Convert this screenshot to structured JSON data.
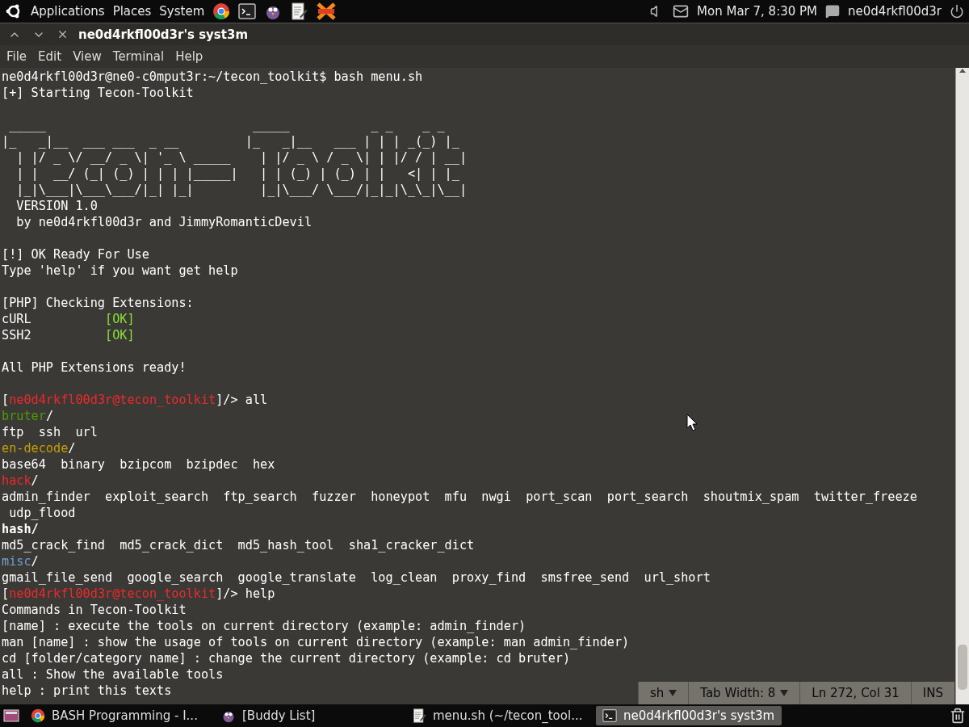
{
  "top_panel": {
    "menus": [
      "Applications",
      "Places",
      "System"
    ],
    "clock": "Mon Mar  7,  8:30 PM",
    "user": "ne0d4rkfl00d3r"
  },
  "terminal": {
    "title": "ne0d4rkfl00d3r's syst3m",
    "menu": [
      "File",
      "Edit",
      "View",
      "Terminal",
      "Help"
    ],
    "lines": [
      {
        "kind": "text",
        "segments": [
          {
            "text": "ne0d4rkfl00d3r@ne0-c0mput3r:~/tecon_toolkit$ bash menu.sh"
          }
        ]
      },
      {
        "kind": "text",
        "segments": [
          {
            "text": "[+] Starting Tecon-Toolkit"
          }
        ]
      },
      {
        "kind": "blank"
      },
      {
        "kind": "text",
        "segments": [
          {
            "text": " _____                            _____           _ _    _ _"
          }
        ]
      },
      {
        "kind": "text",
        "segments": [
          {
            "text": "|_   _|__  ___ ___  _ __         |_   _|__   ___ | | | _(_) |_"
          }
        ]
      },
      {
        "kind": "text",
        "segments": [
          {
            "text": "  | |/ _ \\/ __/ _ \\| '_ \\ _____    | |/ _ \\ / _ \\| | |/ / | __|"
          }
        ]
      },
      {
        "kind": "text",
        "segments": [
          {
            "text": "  | |  __/ (_| (_) | | | |_____|   | | (_) | (_) | |   <| | |_"
          }
        ]
      },
      {
        "kind": "text",
        "segments": [
          {
            "text": "  |_|\\___|\\___\\___/|_| |_|         |_|\\___/ \\___/|_|_|\\_\\_|\\__|"
          }
        ]
      },
      {
        "kind": "text",
        "segments": [
          {
            "text": "  VERSION 1.0"
          }
        ]
      },
      {
        "kind": "text",
        "segments": [
          {
            "text": "  by ne0d4rkfl00d3r and JimmyRomanticDevil"
          }
        ]
      },
      {
        "kind": "blank"
      },
      {
        "kind": "text",
        "segments": [
          {
            "text": "[!] OK Ready For Use"
          }
        ]
      },
      {
        "kind": "text",
        "segments": [
          {
            "text": "Type 'help' if you want get help"
          }
        ]
      },
      {
        "kind": "blank"
      },
      {
        "kind": "text",
        "segments": [
          {
            "text": "[PHP] Checking Extensions:"
          }
        ]
      },
      {
        "kind": "text",
        "segments": [
          {
            "text": "cURL          "
          },
          {
            "text": "[OK]",
            "color": "#8ae234"
          }
        ]
      },
      {
        "kind": "text",
        "segments": [
          {
            "text": "SSH2          "
          },
          {
            "text": "[OK]",
            "color": "#8ae234"
          }
        ]
      },
      {
        "kind": "blank"
      },
      {
        "kind": "text",
        "segments": [
          {
            "text": "All PHP Extensions ready!"
          }
        ]
      },
      {
        "kind": "blank"
      },
      {
        "kind": "text",
        "segments": [
          {
            "text": "["
          },
          {
            "text": "ne0d4rkfl00d3r@tecon_toolkit",
            "color": "#ef2929"
          },
          {
            "text": "]/> all"
          }
        ]
      },
      {
        "kind": "text",
        "segments": [
          {
            "text": "bruter",
            "color": "#4e9a06"
          },
          {
            "text": "/"
          }
        ]
      },
      {
        "kind": "text",
        "segments": [
          {
            "text": "ftp  ssh  url"
          }
        ]
      },
      {
        "kind": "text",
        "segments": [
          {
            "text": "en-decode",
            "color": "#c4a000"
          },
          {
            "text": "/"
          }
        ]
      },
      {
        "kind": "text",
        "segments": [
          {
            "text": "base64  binary  bzipcom  bzipdec  hex"
          }
        ]
      },
      {
        "kind": "text",
        "segments": [
          {
            "text": "hack",
            "color": "#ef2929"
          },
          {
            "text": "/"
          }
        ]
      },
      {
        "kind": "text",
        "segments": [
          {
            "text": "admin_finder  exploit_search  ftp_search  fuzzer  honeypot  mfu  nwgi  port_scan  port_search  shoutmix_spam  twitter_freeze"
          }
        ]
      },
      {
        "kind": "text",
        "segments": [
          {
            "text": " udp_flood"
          }
        ]
      },
      {
        "kind": "text",
        "segments": [
          {
            "text": "hash/",
            "bold": true
          }
        ]
      },
      {
        "kind": "text",
        "segments": [
          {
            "text": "md5_crack_find  md5_crack_dict  md5_hash_tool  sha1_cracker_dict"
          }
        ]
      },
      {
        "kind": "text",
        "segments": [
          {
            "text": "misc",
            "color": "#729fcf"
          },
          {
            "text": "/"
          }
        ]
      },
      {
        "kind": "text",
        "segments": [
          {
            "text": "gmail_file_send  google_search  google_translate  log_clean  proxy_find  smsfree_send  url_short"
          }
        ]
      },
      {
        "kind": "text",
        "segments": [
          {
            "text": "["
          },
          {
            "text": "ne0d4rkfl00d3r@tecon_toolkit",
            "color": "#ef2929"
          },
          {
            "text": "]/> help"
          }
        ]
      },
      {
        "kind": "text",
        "segments": [
          {
            "text": "Commands in Tecon-Toolkit"
          }
        ]
      },
      {
        "kind": "text",
        "segments": [
          {
            "text": "[name] : execute the tools on current directory (example: admin_finder)"
          }
        ]
      },
      {
        "kind": "text",
        "segments": [
          {
            "text": "man [name] : show the usage of tools on current directory (example: man admin_finder)"
          }
        ]
      },
      {
        "kind": "text",
        "segments": [
          {
            "text": "cd [folder/category name] : change the current directory (example: cd bruter)"
          }
        ]
      },
      {
        "kind": "text",
        "segments": [
          {
            "text": "all : Show the available tools"
          }
        ]
      },
      {
        "kind": "text",
        "segments": [
          {
            "text": "help : print this texts"
          }
        ]
      }
    ]
  },
  "editor_status": [
    {
      "text": "sh",
      "dropdown": true
    },
    {
      "text": "Tab Width:  8",
      "dropdown": true
    },
    {
      "text": "Ln 272, Col 31",
      "dropdown": false
    },
    {
      "text": "INS",
      "dropdown": false
    }
  ],
  "taskbar": [
    {
      "label": "BASH Programming - I...",
      "selected": false
    },
    {
      "label": "[Buddy List]",
      "selected": false
    },
    {
      "label": "menu.sh (~/tecon_tool...",
      "selected": false
    },
    {
      "label": "ne0d4rkfl00d3r's syst3m",
      "selected": true
    }
  ]
}
